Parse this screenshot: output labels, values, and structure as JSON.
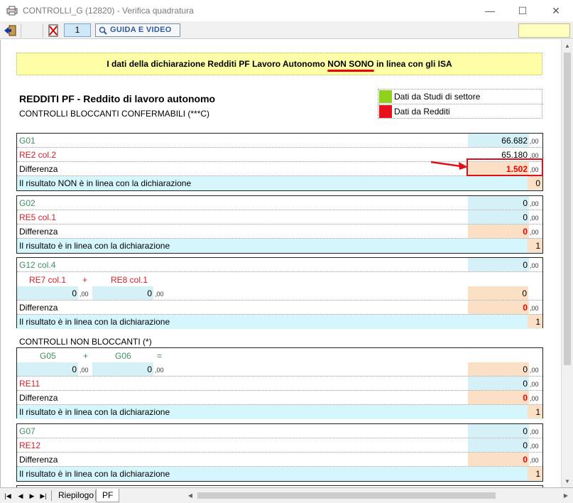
{
  "window": {
    "title": "CONTROLLI_G (12820) - Verifica quadratura",
    "minimize": "—",
    "maximize": "☐",
    "close": "✕"
  },
  "toolbar": {
    "page_number": "1",
    "guide_label": "GUIDA E VIDEO"
  },
  "banner": {
    "prefix": "I dati della dichiarazione Redditi PF Lavoro Autonomo ",
    "emphasis": "NON SONO",
    "suffix": " in linea con gli ISA"
  },
  "header": {
    "title": "REDDITI PF -  Reddito di lavoro autonomo",
    "subtitle": "CONTROLLI BLOCCANTI CONFERMABILI (***C)"
  },
  "legend": {
    "items": [
      {
        "label": "Dati da Studi di settore",
        "color": "#8fd11a"
      },
      {
        "label": "Dati da Redditi",
        "color": "#e8101a"
      }
    ]
  },
  "blocks": {
    "b1": {
      "row1_label": "G01",
      "row1_value": "66.682",
      "row2_label": "RE2 col.2",
      "row2_value": "65.180",
      "diff_label": "Differenza",
      "diff_value": "1.502",
      "result_label": "Il risultato NON è in linea con la dichiarazione",
      "result_value": "0"
    },
    "b2": {
      "row1_label": "G02",
      "row1_value": "0",
      "row2_label": "RE5 col.1",
      "row2_value": "0",
      "diff_label": "Differenza",
      "diff_value": "0",
      "result_label": "Il risultato è in linea con la dichiarazione",
      "result_value": "1"
    },
    "b3": {
      "row1_label": "G12 col.4",
      "row1_value": "0",
      "sub_a_label": "RE7 col.1",
      "plus": "+",
      "sub_b_label": "RE8 col.1",
      "sub_a_value": "0",
      "sub_b_value": "0",
      "sum_value": "0",
      "diff_label": "Differenza",
      "diff_value": "0",
      "result_label": "Il risultato è in linea con la dichiarazione",
      "result_value": "1"
    },
    "nb_title": "CONTROLLI NON BLOCCANTI (*)",
    "b4": {
      "sub_a_label": "G05",
      "plus": "+",
      "sub_b_label": "G06",
      "equals": "=",
      "sub_a_value": "0",
      "sub_b_value": "0",
      "sum_value": "0",
      "row2_label": "RE11",
      "row2_value": "0",
      "diff_label": "Differenza",
      "diff_value": "0",
      "result_label": "Il risultato è in linea con la dichiarazione",
      "result_value": "1"
    },
    "b5": {
      "row1_label": "G07",
      "row1_value": "0",
      "row2_label": "RE12",
      "row2_value": "0",
      "diff_label": "Differenza",
      "diff_value": "0",
      "result_label": "Il risultato è in linea con la dichiarazione",
      "result_value": "1"
    },
    "cents": ",00"
  },
  "tabs": [
    {
      "label": "Riepilogo"
    },
    {
      "label": "PF"
    }
  ]
}
